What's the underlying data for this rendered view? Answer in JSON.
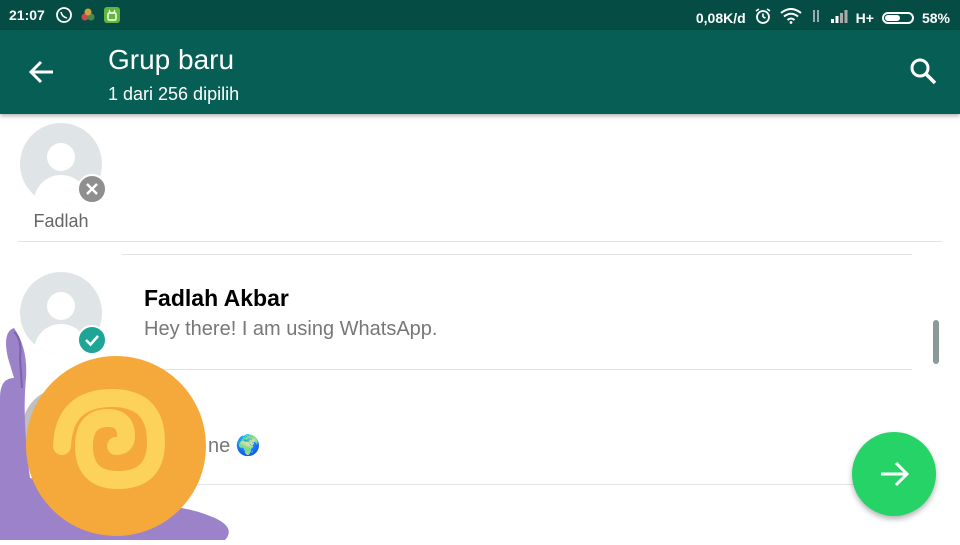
{
  "status_bar": {
    "time": "21:07",
    "network_speed": "0,08K/d",
    "network_type": "H+",
    "battery": "58%",
    "notification_icons": [
      "whatsapp-icon",
      "app-icon",
      "android-icon"
    ],
    "system_icons": [
      "alarm-icon",
      "wifi-icon",
      "signal-icon",
      "battery-icon"
    ]
  },
  "app_bar": {
    "title": "Grup baru",
    "subtitle": "1 dari 256 dipilih",
    "back_icon": "arrow-left-icon",
    "search_icon": "search-icon"
  },
  "selected": [
    {
      "name": "Fadlah",
      "remove_icon": "close-icon"
    }
  ],
  "contacts": [
    {
      "name": "Fadlah Akbar",
      "status": "Hey there! I am using WhatsApp.",
      "selected": true,
      "check_icon": "check-icon"
    },
    {
      "name": "",
      "status": "ne 🌍",
      "selected": false
    }
  ],
  "fab": {
    "icon": "arrow-right-icon"
  },
  "sticker": {
    "icon": "snail-sticker"
  },
  "colors": {
    "status_bar": "#054d44",
    "app_bar": "#075e54",
    "accent": "#25d366",
    "check_badge": "#1fa596",
    "remove_badge": "#8f8f8f"
  }
}
